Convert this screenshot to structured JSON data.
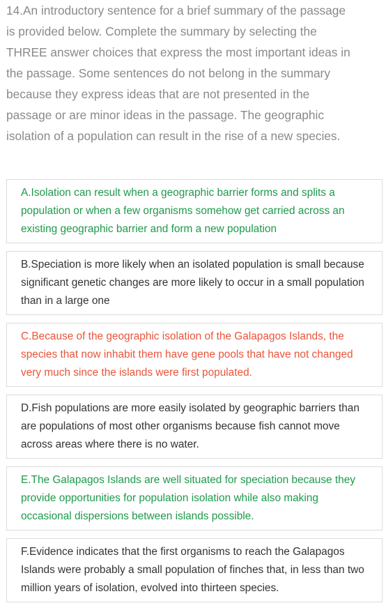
{
  "question": {
    "text": "14.An introductory sentence for a brief summary of the passage is provided below. Complete the summary by selecting the THREE answer choices that express the most important ideas in the passage. Some sentences do not belong in the summary because they express ideas that are not presented in the passage or are minor ideas in the passage. The geographic isolation of a population can result in the rise of a new species."
  },
  "colors": {
    "question_text": "#8a8a8a",
    "correct": "#1e9a4b",
    "wrong": "#e8553a",
    "neutral": "#333333",
    "border": "#dcdcdc"
  },
  "options": [
    {
      "text": "A.Isolation can result when a geographic barrier forms and splits a population or when a few organisms somehow get carried across an existing geographic barrier and form a new population",
      "status": "correct"
    },
    {
      "text": "B.Speciation is more likely when an isolated population is small because significant genetic changes are more likely to occur in a small population than in a large one",
      "status": "neutral"
    },
    {
      "text": "C.Because of the geographic isolation of the Galapagos Islands, the species that now inhabit them have gene pools that have not changed very much since the islands were first populated.",
      "status": "wrong"
    },
    {
      "text": "D.Fish populations are more easily isolated by geographic barriers than are populations of most other organisms because fish cannot move across areas where there is no water.",
      "status": "neutral"
    },
    {
      "text": "E.The Galapagos Islands are well situated for speciation because they provide opportunities for population isolation while also making occasional dispersions between islands possible.",
      "status": "correct"
    },
    {
      "text": "F.Evidence indicates that the first organisms to reach the Galapagos Islands were probably a small population of finches that, in less than two million years of isolation, evolved into thirteen species.",
      "status": "neutral"
    }
  ]
}
